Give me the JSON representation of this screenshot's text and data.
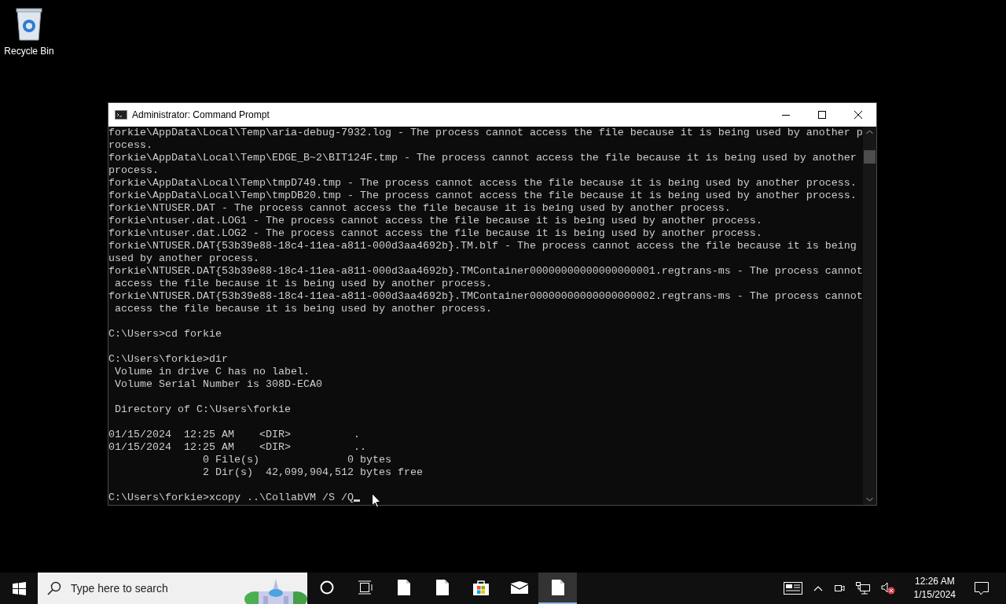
{
  "desktop": {
    "icons": [
      {
        "label": "Recycle Bin"
      }
    ]
  },
  "window": {
    "title": "Administrator: Command Prompt",
    "console": {
      "blocks": [
        [
          "forkie\\AppData\\Local\\Temp\\aria-debug-7932.log - The process cannot access the file because it is being used by another p",
          "rocess.",
          "forkie\\AppData\\Local\\Temp\\EDGE_B~2\\BIT124F.tmp - The process cannot access the file because it is being used by another",
          "process.",
          "forkie\\AppData\\Local\\Temp\\tmpD749.tmp - The process cannot access the file because it is being used by another process.",
          "forkie\\AppData\\Local\\Temp\\tmpDB20.tmp - The process cannot access the file because it is being used by another process.",
          "forkie\\NTUSER.DAT - The process cannot access the file because it is being used by another process.",
          "forkie\\ntuser.dat.LOG1 - The process cannot access the file because it is being used by another process.",
          "forkie\\ntuser.dat.LOG2 - The process cannot access the file because it is being used by another process.",
          "forkie\\NTUSER.DAT{53b39e88-18c4-11ea-a811-000d3aa4692b}.TM.blf - The process cannot access the file because it is being",
          "used by another process.",
          "forkie\\NTUSER.DAT{53b39e88-18c4-11ea-a811-000d3aa4692b}.TMContainer00000000000000000001.regtrans-ms - The process cannot",
          " access the file because it is being used by another process.",
          "forkie\\NTUSER.DAT{53b39e88-18c4-11ea-a811-000d3aa4692b}.TMContainer00000000000000000002.regtrans-ms - The process cannot",
          " access the file because it is being used by another process."
        ],
        [
          "C:\\Users>cd forkie"
        ],
        [
          "C:\\Users\\forkie>dir",
          " Volume in drive C has no label.",
          " Volume Serial Number is 308D-ECA0"
        ],
        [
          " Directory of C:\\Users\\forkie"
        ],
        [
          "01/15/2024  12:25 AM    <DIR>          .",
          "01/15/2024  12:25 AM    <DIR>          ..",
          "               0 File(s)              0 bytes",
          "               2 Dir(s)  42,099,904,512 bytes free"
        ],
        [
          "C:\\Users\\forkie>xcopy ..\\CollabVM /S /Q"
        ]
      ]
    }
  },
  "taskbar": {
    "search": {
      "placeholder": "Type here to search"
    },
    "apps": [
      {
        "kind": "cortana",
        "selected": false
      },
      {
        "kind": "taskview",
        "selected": false
      },
      {
        "kind": "file",
        "selected": false
      },
      {
        "kind": "file",
        "selected": false
      },
      {
        "kind": "store",
        "selected": false
      },
      {
        "kind": "mail",
        "selected": false
      },
      {
        "kind": "file",
        "selected": true
      }
    ],
    "clock": {
      "time": "12:26 AM",
      "date": "1/15/2024"
    }
  }
}
